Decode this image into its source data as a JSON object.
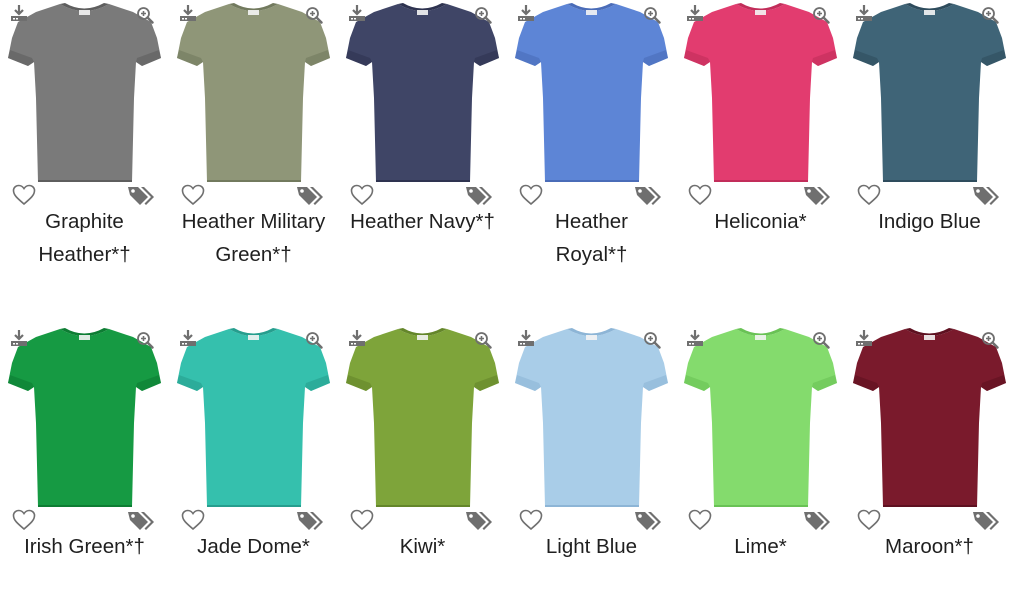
{
  "products": [
    {
      "line1": "Graphite",
      "line2": "Heather*†",
      "color": "#7a7a7a",
      "shade": "#5e5e5e"
    },
    {
      "line1": "Heather Military",
      "line2": "Green*†",
      "color": "#8f9678",
      "shade": "#727a5e"
    },
    {
      "line1": "Heather Navy*†",
      "line2": "",
      "color": "#3f4566",
      "shade": "#2e3350"
    },
    {
      "line1": "Heather",
      "line2": "Royal*†",
      "color": "#5d85d6",
      "shade": "#4a6cb8"
    },
    {
      "line1": "Heliconia*",
      "line2": "",
      "color": "#e23c6f",
      "shade": "#c22d5a"
    },
    {
      "line1": "Indigo Blue",
      "line2": "",
      "color": "#3f6477",
      "shade": "#2e4c5d"
    },
    {
      "line1": "Irish Green*†",
      "line2": "",
      "color": "#169a43",
      "shade": "#0d7d33"
    },
    {
      "line1": "Jade Dome*",
      "line2": "",
      "color": "#35c0ad",
      "shade": "#269e8e"
    },
    {
      "line1": "Kiwi*",
      "line2": "",
      "color": "#7ea43a",
      "shade": "#64862a"
    },
    {
      "line1": "Light Blue",
      "line2": "",
      "color": "#a9cde8",
      "shade": "#8db5d6"
    },
    {
      "line1": "Lime*",
      "line2": "",
      "color": "#84db6d",
      "shade": "#69c255"
    },
    {
      "line1": "Maroon*†",
      "line2": "",
      "color": "#7a1a2c",
      "shade": "#5e1020"
    }
  ],
  "icons": {
    "download": "download-icon",
    "zoom": "zoom-in-icon",
    "favorite": "heart-icon",
    "price_tag": "price-tag-icon"
  },
  "colors": {
    "icon_gray": "#6f6f6f",
    "text": "#1f1f1f"
  }
}
